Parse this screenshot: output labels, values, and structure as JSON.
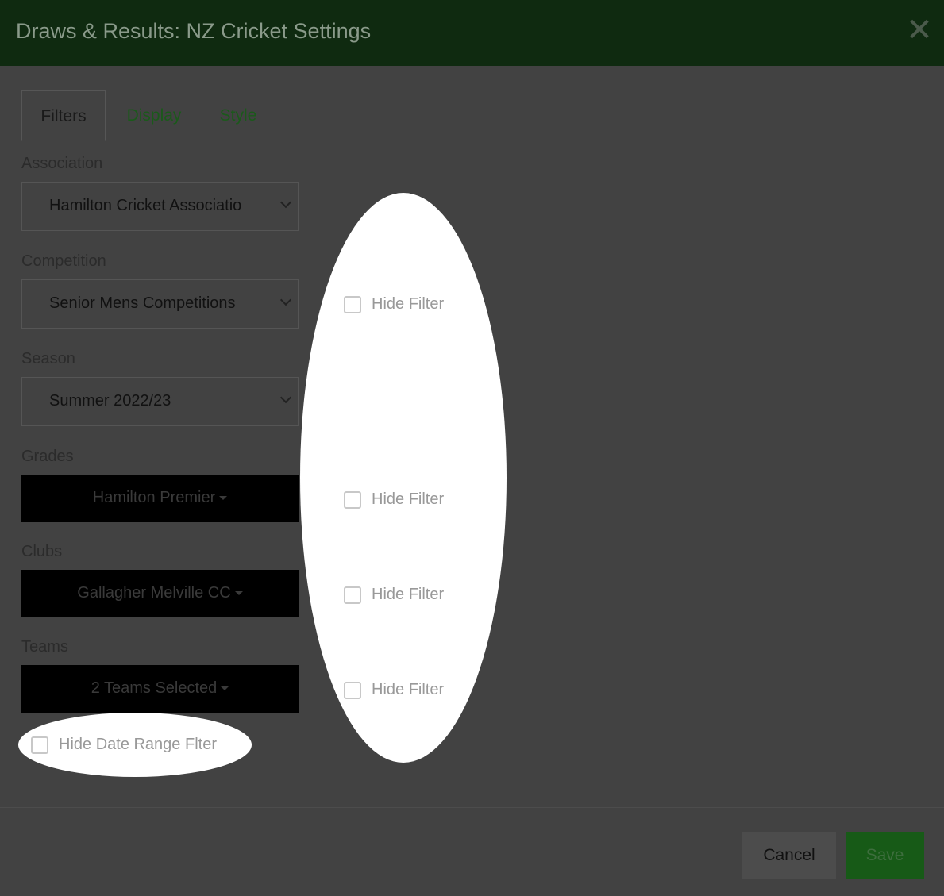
{
  "header": {
    "title": "Draws & Results: NZ Cricket Settings",
    "close_glyph": "✕"
  },
  "tabs": [
    {
      "label": "Filters"
    },
    {
      "label": "Display"
    },
    {
      "label": "Style"
    }
  ],
  "fields": {
    "association": {
      "label": "Association",
      "value": "Hamilton Cricket Associatio"
    },
    "competition": {
      "label": "Competition",
      "value": "Senior Mens Competitions"
    },
    "season": {
      "label": "Season",
      "value": "Summer 2022/23"
    },
    "grades": {
      "label": "Grades",
      "value": "Hamilton Premier"
    },
    "clubs": {
      "label": "Clubs",
      "value": "Gallagher Melville CC"
    },
    "teams": {
      "label": "Teams",
      "value": "2 Teams Selected"
    }
  },
  "hide_filter_label": "Hide Filter",
  "hide_date_range_label": "Hide Date Range Flter",
  "footer": {
    "cancel_label": "Cancel",
    "save_label": "Save"
  },
  "colors": {
    "header_bg": "#0f2a10",
    "accent_green": "#175a17",
    "body_bg": "#424242"
  }
}
